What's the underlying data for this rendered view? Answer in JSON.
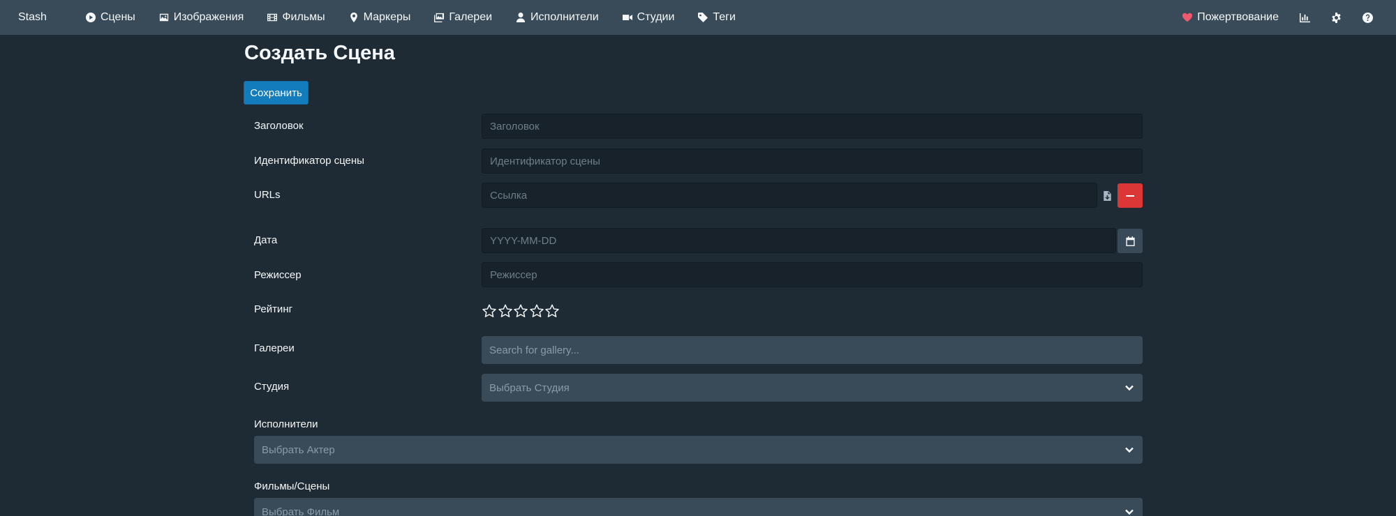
{
  "nav": {
    "brand": "Stash",
    "items": [
      {
        "label": "Сцены",
        "icon": "play-circle-icon"
      },
      {
        "label": "Изображения",
        "icon": "image-icon"
      },
      {
        "label": "Фильмы",
        "icon": "film-icon"
      },
      {
        "label": "Маркеры",
        "icon": "map-marker-icon"
      },
      {
        "label": "Галереи",
        "icon": "images-icon"
      },
      {
        "label": "Исполнители",
        "icon": "user-icon"
      },
      {
        "label": "Студии",
        "icon": "video-icon"
      },
      {
        "label": "Теги",
        "icon": "tag-icon"
      }
    ],
    "donate": "Пожертвование",
    "right_icons": [
      "stats-chart-icon",
      "gear-icon",
      "help-icon"
    ]
  },
  "page": {
    "title": "Создать Сцена",
    "save_label": "Сохранить"
  },
  "form": {
    "title": {
      "label": "Заголовок",
      "placeholder": "Заголовок",
      "value": ""
    },
    "code": {
      "label": "Идентификатор сцены",
      "placeholder": "Идентификатор сцены",
      "value": ""
    },
    "urls": {
      "label": "URLs",
      "placeholder": "Ссылка",
      "value": ""
    },
    "date": {
      "label": "Дата",
      "placeholder": "YYYY-MM-DD",
      "value": ""
    },
    "director": {
      "label": "Режиссер",
      "placeholder": "Режиссер",
      "value": ""
    },
    "rating": {
      "label": "Рейтинг",
      "value": 0,
      "max": 5
    },
    "galleries": {
      "label": "Галереи",
      "placeholder": "Search for gallery..."
    },
    "studio": {
      "label": "Студия",
      "placeholder": "Выбрать Студия"
    },
    "performers": {
      "label": "Исполнители",
      "placeholder": "Выбрать Актер"
    },
    "movies": {
      "label": "Фильмы/Сцены",
      "placeholder": "Выбрать Фильм"
    }
  },
  "colors": {
    "background": "#1f2b34",
    "navbar": "#394b59",
    "primary": "#137cbd",
    "danger": "#db3737",
    "input": "#17222a",
    "heart": "#f0596b"
  }
}
